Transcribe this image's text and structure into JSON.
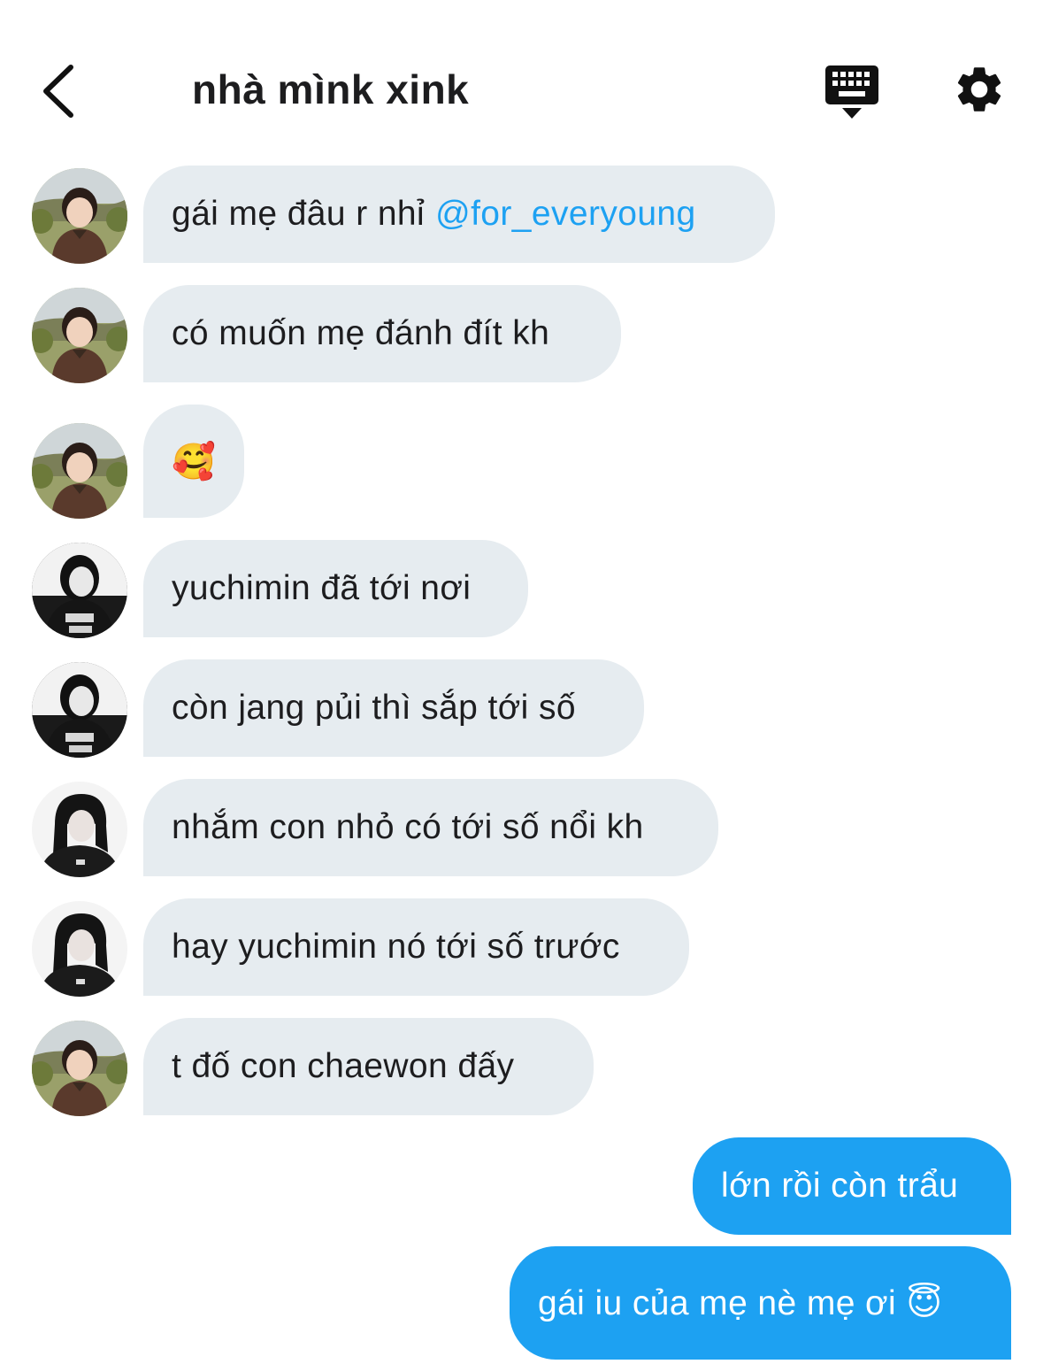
{
  "header": {
    "title": "nhà mìnk xink",
    "back_icon": "chevron-left-icon",
    "keyboard_icon": "keyboard-hide-icon",
    "settings_icon": "gear-icon"
  },
  "colors": {
    "accent": "#1da1f2",
    "incoming_bubble": "#e6ecf0",
    "text": "#14171a"
  },
  "messages": [
    {
      "sender": "avatar-1",
      "text": "gái mẹ đâu r nhỉ",
      "mention": "@for_everyoung"
    },
    {
      "sender": "avatar-1",
      "text": "có muốn mẹ đánh đít kh"
    },
    {
      "sender": "avatar-1",
      "text": "🥰"
    },
    {
      "sender": "avatar-2",
      "text": "yuchimin đã tới nơi"
    },
    {
      "sender": "avatar-2",
      "text": "còn jang pủi thì sắp tới số"
    },
    {
      "sender": "avatar-3",
      "text": "nhắm con nhỏ có tới số nổi kh"
    },
    {
      "sender": "avatar-3",
      "text": "hay yuchimin nó tới số trước"
    },
    {
      "sender": "avatar-1",
      "text": "t đố con chaewon đấy"
    },
    {
      "sender": "me",
      "text": "lớn rồi còn trẩu"
    },
    {
      "sender": "me",
      "text": "gái iu của mẹ nè mẹ ơi 😇"
    }
  ]
}
